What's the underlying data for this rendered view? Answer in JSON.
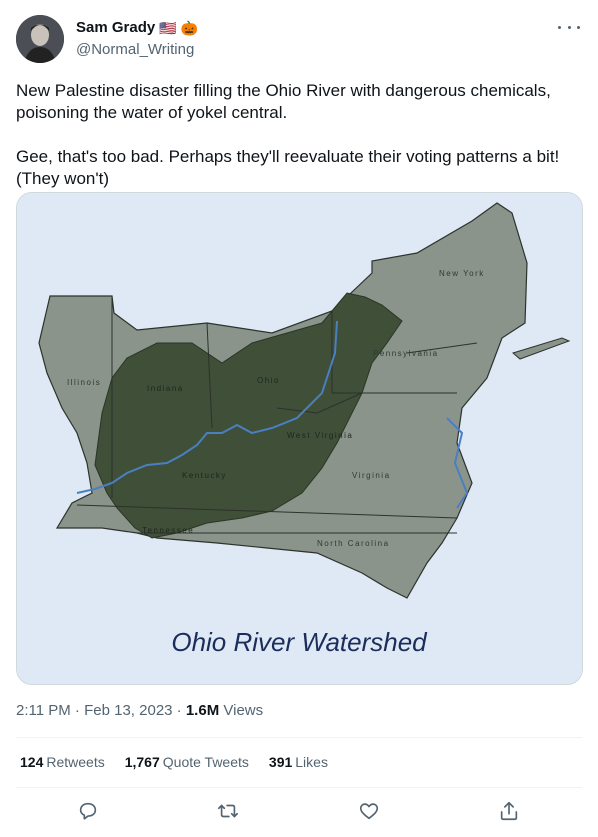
{
  "author": {
    "display_name": "Sam Grady",
    "handle": "@Normal_Writing",
    "badges": [
      "us-flag-emoji",
      "jack-o-lantern-emoji"
    ]
  },
  "tweet": {
    "paragraph_1": "New Palestine disaster filling the Ohio River with dangerous chemicals, poisoning the water of yokel central.",
    "paragraph_2_line_1": "Gee, that's too bad. Perhaps they'll reevaluate their voting patterns a bit!",
    "paragraph_2_line_2": "(They won't)"
  },
  "media": {
    "caption": "Ohio River Watershed",
    "labels": {
      "new_york": "New York",
      "pennsylvania": "Pennsylvania",
      "illinois": "Illinois",
      "indiana": "Indiana",
      "ohio": "Ohio",
      "west_virginia": "West Virginia",
      "virginia": "Virginia",
      "kentucky": "Kentucky",
      "tennessee": "Tennessee",
      "north_carolina": "North Carolina"
    },
    "colors": {
      "background": "#dfe9f6",
      "states": "#8a948b",
      "watershed": "#3f4f38",
      "river": "#4a7fc1",
      "caption": "#1b2d5a"
    }
  },
  "meta": {
    "time": "2:11 PM",
    "separator": "·",
    "date": "Feb 13, 2023",
    "views_count": "1.6M",
    "views_label": "Views"
  },
  "stats": {
    "retweets_count": "124",
    "retweets_label": "Retweets",
    "quotes_count": "1,767",
    "quotes_label": "Quote Tweets",
    "likes_count": "391",
    "likes_label": "Likes"
  },
  "actions": [
    "reply-icon",
    "retweet-icon",
    "like-icon",
    "share-icon"
  ]
}
